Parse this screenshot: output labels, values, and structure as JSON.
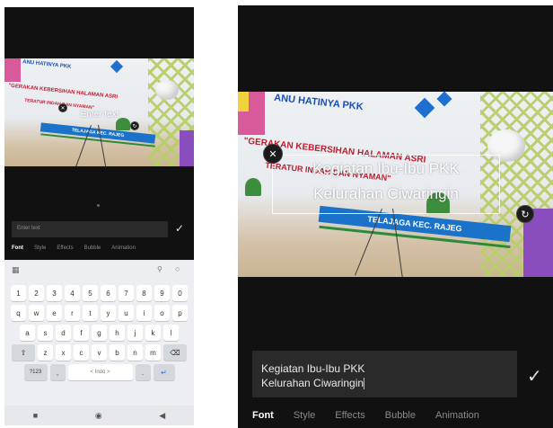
{
  "left": {
    "overlay_text": "Enter text",
    "delete_icon": "close-icon",
    "resize_icon": "rotate-icon",
    "input_placeholder": "Enter text",
    "confirm_icon": "check-icon",
    "tabs": [
      "Font",
      "Style",
      "Effects",
      "Bubble",
      "Animation"
    ],
    "active_tab": "Font",
    "keyboard": {
      "top_left_icon": "grid-icon",
      "top_icons": [
        "lock-icon",
        "search-icon"
      ],
      "row_numbers": [
        "1",
        "2",
        "3",
        "4",
        "5",
        "6",
        "7",
        "8",
        "9",
        "0"
      ],
      "row1": [
        "q",
        "w",
        "e",
        "r",
        "t",
        "y",
        "u",
        "i",
        "o",
        "p"
      ],
      "row2": [
        "a",
        "s",
        "d",
        "f",
        "g",
        "h",
        "j",
        "k",
        "l"
      ],
      "row3": [
        "z",
        "x",
        "c",
        "v",
        "b",
        "n",
        "m"
      ],
      "shift_icon": "shift-icon",
      "backspace_icon": "backspace-icon",
      "symbols_key": "?123",
      "comma_key": ",",
      "space_label": "< Indo >",
      "period_key": ".",
      "enter_icon": "enter-icon"
    },
    "navbar": {
      "recent_icon": "square-icon",
      "home_icon": "circle-icon",
      "back_icon": "triangle-back-icon"
    }
  },
  "right": {
    "overlay_line1": "Kegiatan Ibu-Ibu PKK",
    "overlay_line2": "Kelurahan Ciwaringin",
    "delete_icon": "close-icon",
    "resize_icon": "rotate-icon",
    "input_line1": "Kegiatan Ibu-Ibu PKK",
    "input_line2": "Kelurahan Ciwaringin",
    "confirm_icon": "check-icon",
    "tabs": [
      "Font",
      "Style",
      "Effects",
      "Bubble",
      "Animation"
    ],
    "active_tab": "Font"
  },
  "photo_sign": {
    "header": "ANU HATINYA PKK",
    "red_line1": "\"GERAKAN KEBERSIHAN HALAMAN ASRI",
    "red_line2": "TERATUR INDAH DAN NYAMAN\"",
    "blue_banner": "TELAJAGA KEC. RAJEG"
  },
  "colors": {
    "panel_bg": "#111111",
    "sign_red": "#c21b2e",
    "sign_blue": "#1a73c9",
    "lattice_green": "#b7cf6a"
  }
}
